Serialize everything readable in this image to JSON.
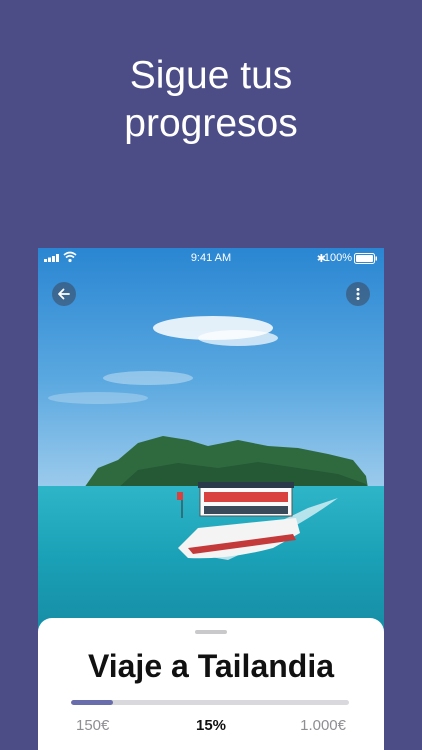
{
  "headline": {
    "line1": "Sigue tus",
    "line2": "progresos"
  },
  "status_bar": {
    "time": "9:41 AM",
    "battery": "100%"
  },
  "trip": {
    "title": "Viaje a Tailandia",
    "saved": "150€",
    "percent": "15%",
    "goal": "1.000€",
    "progress": 0.15
  },
  "colors": {
    "background": "#4c4d87",
    "accent": "#6a6dab"
  },
  "icons": [
    "back-arrow-icon",
    "more-vertical-icon",
    "wifi-icon",
    "bluetooth-icon",
    "battery-icon"
  ]
}
